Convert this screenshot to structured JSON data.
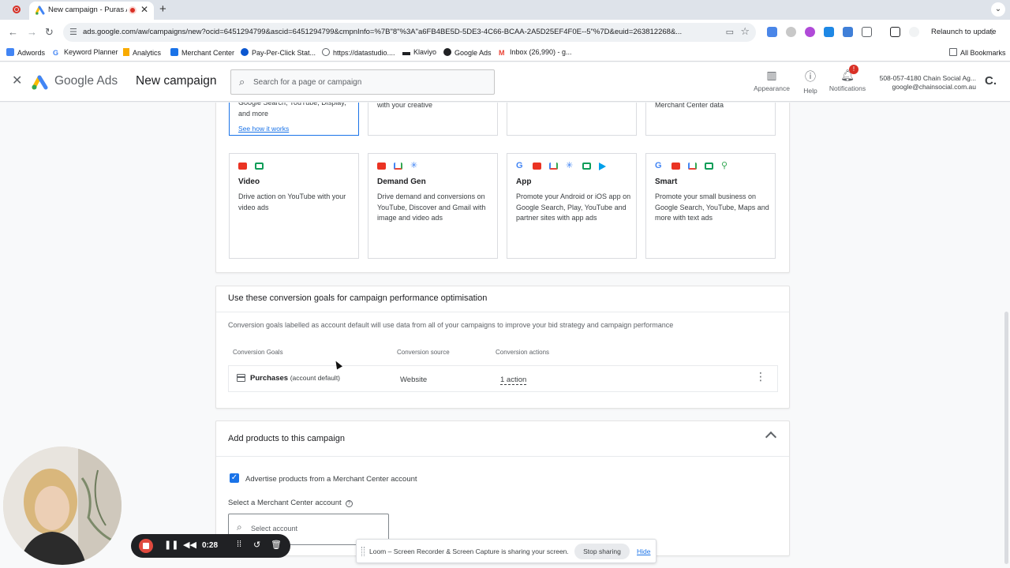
{
  "browser": {
    "tab_title": "New campaign - Puras A…",
    "url": "ads.google.com/aw/campaigns/new?ocid=6451294799&ascid=6451294799&cmpnInfo=%7B\"8\"%3A\"a6FB4BE5D-5DE3-4C66-BCAA-2A5D25EF4F0E--5\"%7D&euid=263812268&...",
    "relaunch_label": "Relaunch to update",
    "bookmarks": [
      "Adwords",
      "Keyword Planner",
      "Analytics",
      "Merchant Center",
      "Pay-Per-Click Stat...",
      "https://datastudio....",
      "Klaviyo",
      "Google Ads",
      "Inbox (26,990) - g..."
    ],
    "all_bookmarks": "All Bookmarks"
  },
  "header": {
    "product": "Google Ads",
    "page_title": "New campaign",
    "search_placeholder": "Search for a page or campaign",
    "appearance": "Appearance",
    "help": "Help",
    "notifications": "Notifications",
    "notification_count": "!",
    "account_id": "508-057-4180 Chain Social Ag...",
    "account_email": "google@chainsocial.com.au"
  },
  "campaign_types_top": {
    "search_desc": "Google Search, YouTube, Display, and more",
    "see_how": "See how it works",
    "pmax_partial": "with your creative",
    "shopping_partial": "Merchant Center data"
  },
  "campaign_types": [
    {
      "name": "Video",
      "desc": "Drive action on YouTube with your video ads"
    },
    {
      "name": "Demand Gen",
      "desc": "Drive demand and conversions on YouTube, Discover and Gmail with image and video ads"
    },
    {
      "name": "App",
      "desc": "Promote your Android or iOS app on Google Search, Play, YouTube and partner sites with app ads"
    },
    {
      "name": "Smart",
      "desc": "Promote your small business on Google Search, YouTube, Maps and more with text ads"
    }
  ],
  "goals": {
    "title": "Use these conversion goals for campaign performance optimisation",
    "note": "Conversion goals labelled as account default will use data from all of your campaigns to improve your bid strategy and campaign performance",
    "columns": [
      "Conversion Goals",
      "Conversion source",
      "Conversion actions"
    ],
    "row": {
      "name": "Purchases",
      "tag": "(account default)",
      "source": "Website",
      "actions": "1 action"
    }
  },
  "products": {
    "title": "Add products to this campaign",
    "checkbox_label": "Advertise products from a Merchant Center account",
    "checked": true,
    "select_label": "Select a Merchant Center account",
    "select_placeholder": "Select account"
  },
  "loom": {
    "timer": "0:28",
    "share_message": "Loom – Screen Recorder & Screen Capture is sharing your screen.",
    "stop_sharing": "Stop sharing",
    "hide": "Hide"
  }
}
